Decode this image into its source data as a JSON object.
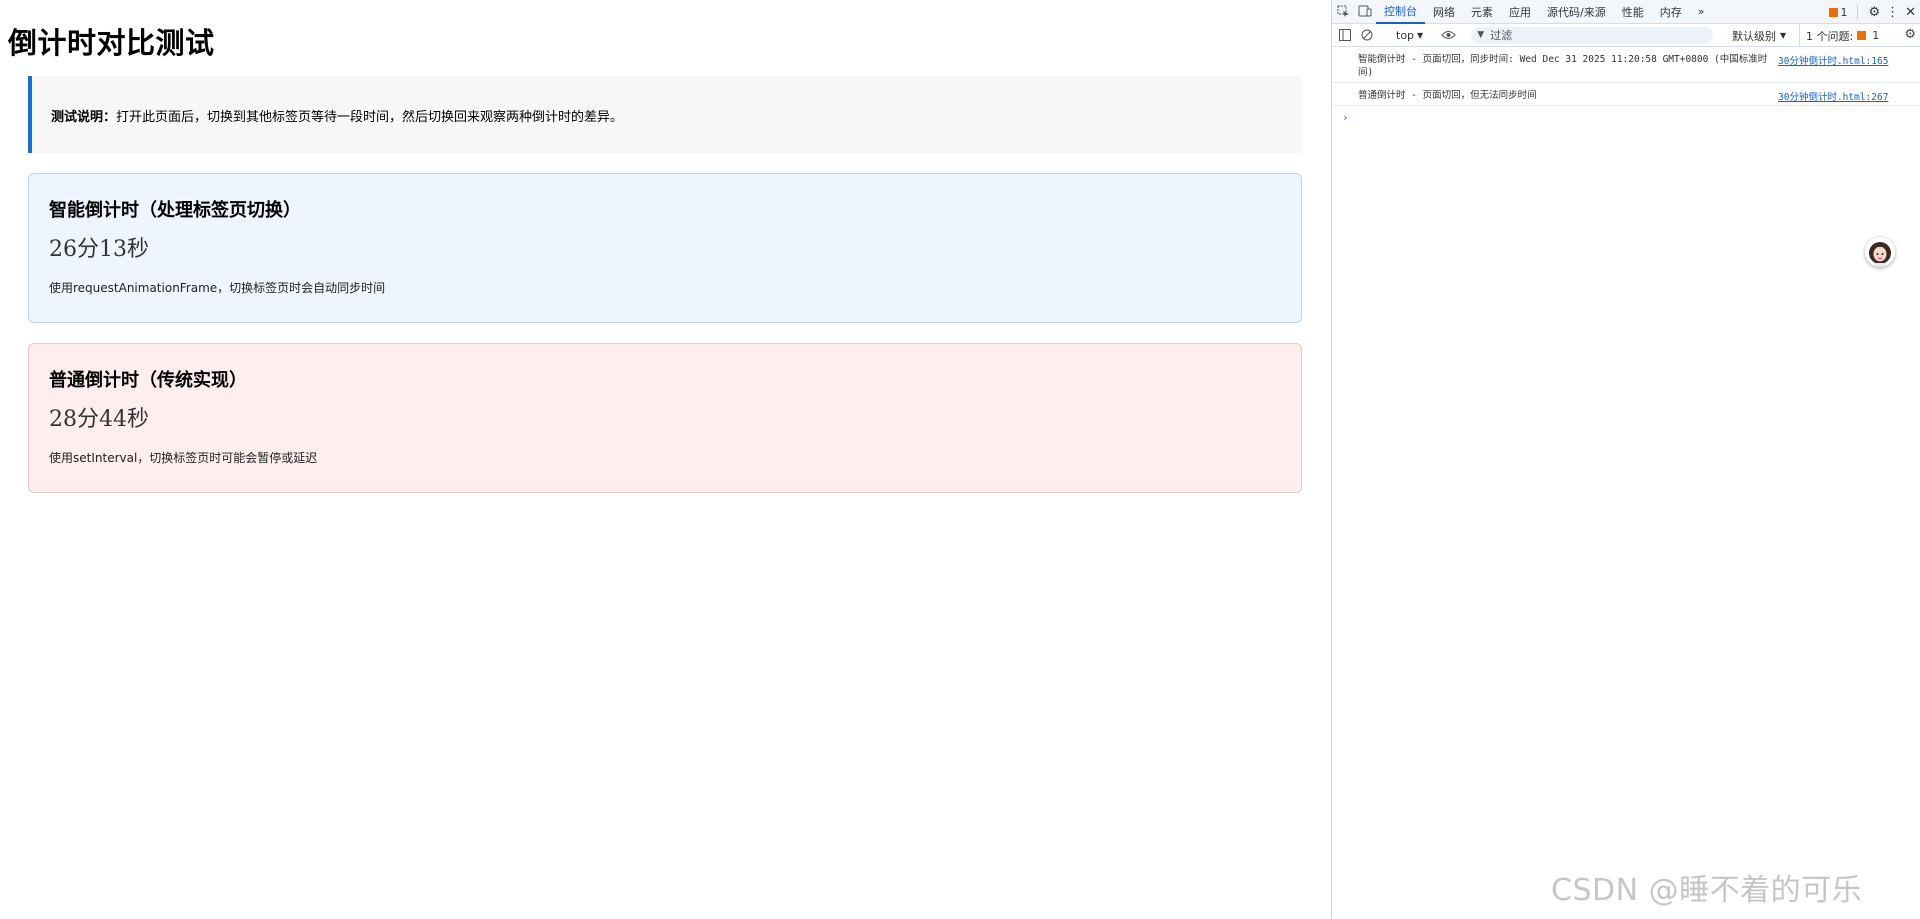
{
  "page": {
    "title": "倒计时对比测试",
    "note": {
      "label": "测试说明：",
      "text": "打开此页面后，切换到其他标签页等待一段时间，然后切换回来观察两种倒计时的差异。"
    },
    "smart_card": {
      "title": "智能倒计时（处理标签页切换）",
      "timer": "26分13秒",
      "desc": "使用requestAnimationFrame，切换标签页时会自动同步时间",
      "bg_color": "#eef5ff"
    },
    "normal_card": {
      "title": "普通倒计时（传统实现）",
      "timer": "28分44秒",
      "desc": "使用setInterval，切换标签页时可能会暂停或延迟",
      "bg_color": "#ffeeee"
    }
  },
  "devtools": {
    "tabs": [
      "控制台",
      "网络",
      "元素",
      "应用",
      "源代码/来源",
      "性能",
      "内存"
    ],
    "active_tab": "控制台",
    "more_tabs": "»",
    "issue_badge_count": "1",
    "toolbar": {
      "context": "top",
      "filter_placeholder": "过滤",
      "level": "默认级别",
      "issues_label": "1 个问题:",
      "issues_count": "1"
    },
    "logs": [
      {
        "message": "智能倒计时 - 页面切回，同步时间: Wed Dec 31 2025 11:20:58 GMT+0800 (中国标准时间)",
        "source": "30分钟倒计时.html:165"
      },
      {
        "message": "普通倒计时 - 页面切回，但无法同步时间",
        "source": "30分钟倒计时.html:267"
      }
    ],
    "prompt_symbol": "›"
  },
  "watermark": "CSDN @睡不着的可乐",
  "colors": {
    "accent": "#1a73c8",
    "devtools_link": "#1a5fd0",
    "issue_flag": "#e8710a"
  }
}
